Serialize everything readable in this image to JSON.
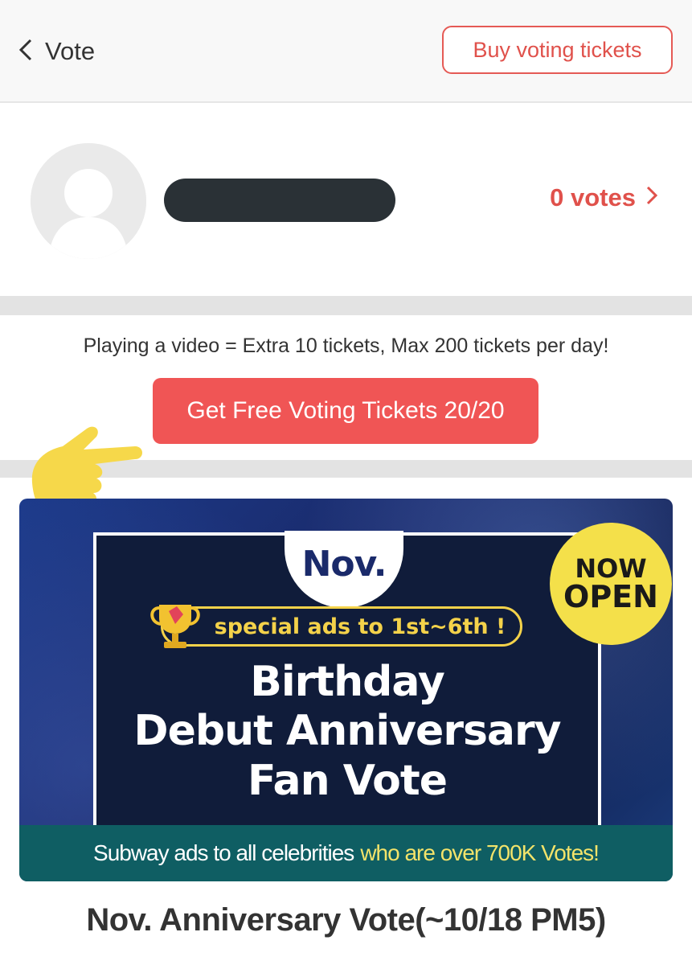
{
  "header": {
    "back_label": "Vote",
    "buy_button": "Buy voting tickets"
  },
  "profile": {
    "votes_label": "0 votes"
  },
  "free_tickets": {
    "info_text": "Playing a video = Extra 10 tickets, Max 200 tickets per day!",
    "button_label": "Get Free Voting Tickets 20/20"
  },
  "banner": {
    "month_badge": "Nov.",
    "now_open_line1": "NOW",
    "now_open_line2": "OPEN",
    "special_text": "special ads to 1st~6th !",
    "title_line1": "Birthday",
    "title_line2": "Debut Anniversary",
    "title_line3": "Fan Vote",
    "footer_white": "Subway ads to all celebrities",
    "footer_yellow": "who are over 700K Votes!"
  },
  "vote_title": "Nov. Anniversary Vote(~10/18 PM5)",
  "colors": {
    "accent": "#e0514b",
    "button": "#f05555",
    "banner_highlight": "#f4d24a"
  },
  "icons": {
    "back": "chevron-left-icon",
    "votes": "chevron-right-icon",
    "hand": "pointing-hand-icon",
    "trophy": "trophy-icon"
  }
}
